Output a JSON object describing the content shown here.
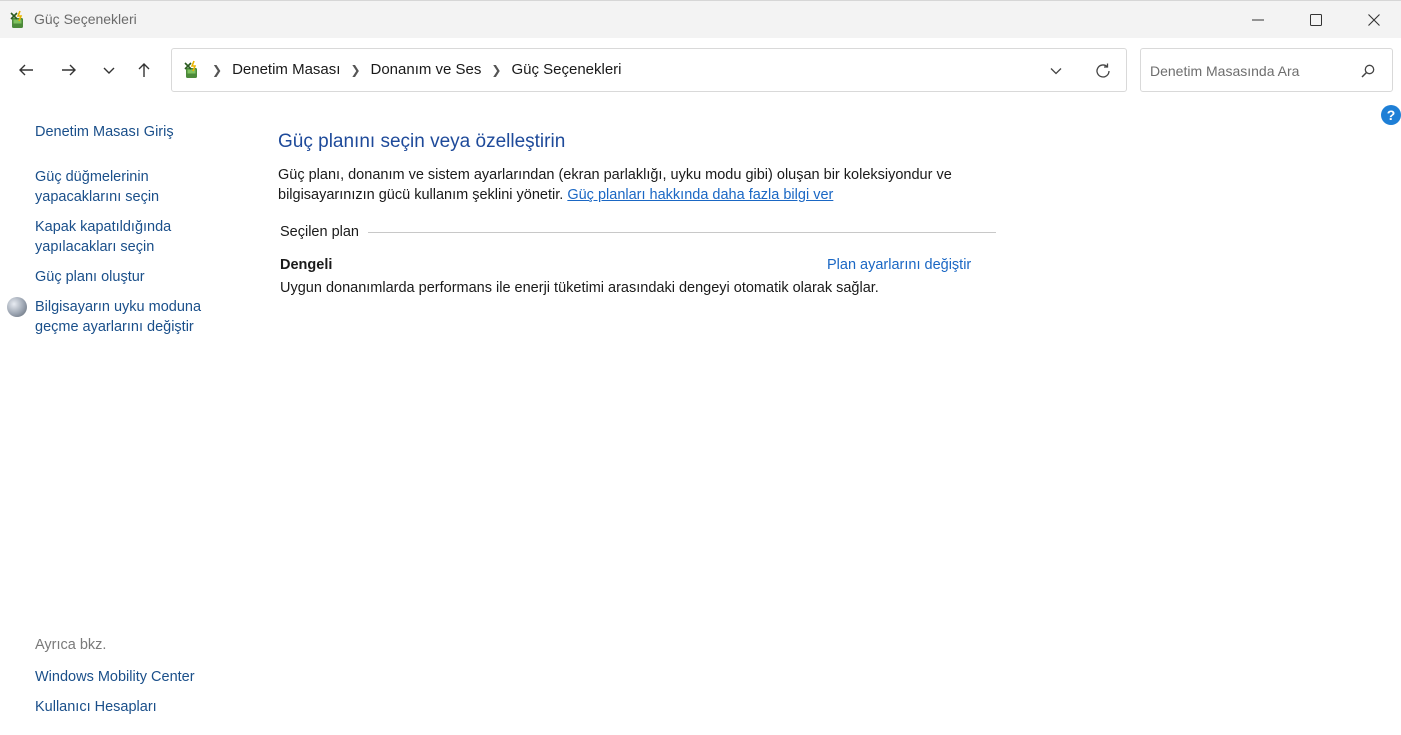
{
  "window": {
    "title": "Güç Seçenekleri"
  },
  "navigation": {
    "breadcrumbs": [
      "Denetim Masası",
      "Donanım ve Ses",
      "Güç Seçenekleri"
    ]
  },
  "search": {
    "placeholder": "Denetim Masasında Ara"
  },
  "sidebar": {
    "home": "Denetim Masası Giriş",
    "links": [
      "Güç düğmelerinin yapacaklarını seçin",
      "Kapak kapatıldığında yapılacakları seçin",
      "Güç planı oluştur",
      "Bilgisayarın uyku moduna geçme ayarlarını değiştir"
    ],
    "see_also_label": "Ayrıca bkz.",
    "see_also": [
      "Windows Mobility Center",
      "Kullanıcı Hesapları"
    ]
  },
  "main": {
    "title": "Güç planını seçin veya özelleştirin",
    "description": "Güç planı, donanım ve sistem ayarlarından (ekran parlaklığı, uyku modu gibi) oluşan bir koleksiyondur ve bilgisayarınızın gücü kullanım şeklini yönetir.",
    "learn_more_link": "Güç planları hakkında daha fazla bilgi ver",
    "selected_plan_label": "Seçilen plan",
    "plan": {
      "name": "Dengeli",
      "change_link": "Plan ayarlarını değiştir",
      "description": "Uygun donanımlarda performans ile enerji tüketimi arasındaki dengeyi otomatik olarak sağlar."
    }
  },
  "icons": {
    "app": "power-options-icon",
    "help": "help-icon"
  },
  "colors": {
    "link": "#1a67c4",
    "title": "#1e4a9a",
    "sidebar_link": "#1a4f8a"
  }
}
